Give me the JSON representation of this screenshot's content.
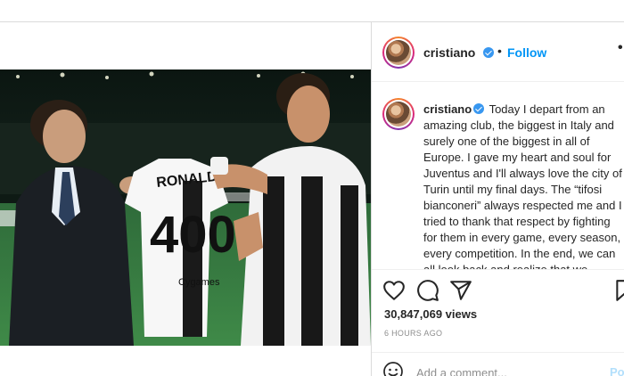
{
  "post": {
    "username": "cristiano",
    "follow_label": "Follow",
    "more_label": "••",
    "dot_separator": "•",
    "caption": {
      "username": "cristiano",
      "text": "Today I depart from an amazing club, the biggest in Italy and surely one of the biggest in all of Europe. I gave my heart and soul for Juventus and I'll always love the city of Turin until my final days. The “tifosi bianconeri” always respected me and I tried to thank that respect by fighting for them in every game, every season, every competition. In the end, we can all look back and realize that we"
    },
    "views": "30,847,069 views",
    "timestamp": "6 HOURS AGO",
    "comment_placeholder": "Add a comment...",
    "post_button_label": "Po"
  },
  "media": {
    "jersey_name": "RONALDO",
    "jersey_number": "400",
    "jersey_sponsor": "Cygames"
  },
  "icons": {
    "verified": "verified-badge-icon",
    "heart": "heart-icon",
    "comment": "comment-icon",
    "share": "share-icon",
    "save": "bookmark-icon",
    "emoji": "emoji-icon"
  },
  "colors": {
    "accent": "#0095f6",
    "verified": "#3897f0",
    "text": "#262626",
    "muted": "#8e8e8e",
    "border": "#dbdbdb"
  }
}
